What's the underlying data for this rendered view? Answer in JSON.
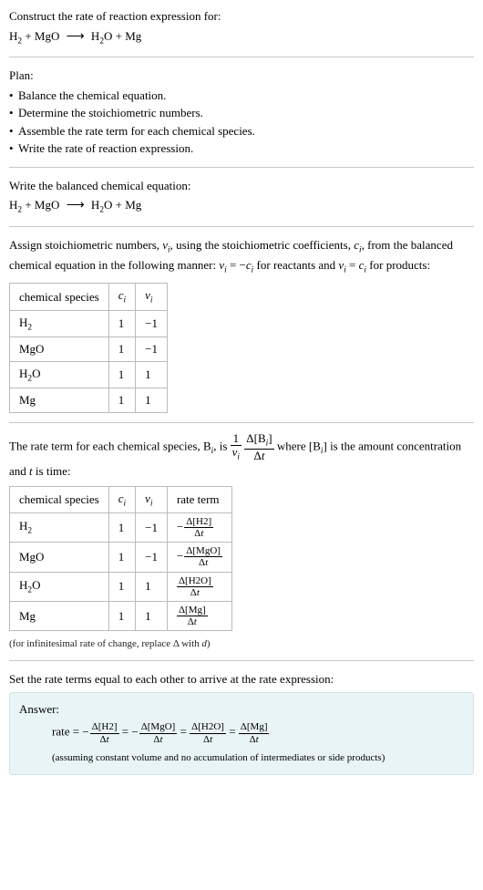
{
  "header": {
    "prompt": "Construct the rate of reaction expression for:",
    "equation_left": "H",
    "equation_sub1": "2",
    "equation_plus1": " + MgO ",
    "equation_right": " H",
    "equation_sub2": "2",
    "equation_end": "O + Mg"
  },
  "plan": {
    "title": "Plan:",
    "items": [
      "Balance the chemical equation.",
      "Determine the stoichiometric numbers.",
      "Assemble the rate term for each chemical species.",
      "Write the rate of reaction expression."
    ]
  },
  "balanced": {
    "title": "Write the balanced chemical equation:"
  },
  "stoich_intro": {
    "part1": "Assign stoichiometric numbers, ",
    "nu": "ν",
    "sub_i": "i",
    "part2": ", using the stoichiometric coefficients, ",
    "c": "c",
    "part3": ", from the balanced chemical equation in the following manner: ",
    "eq1": " = −",
    "part4": " for reactants and ",
    "eq2": " = ",
    "part5": " for products:"
  },
  "table1": {
    "headers": [
      "chemical species",
      "cᵢ",
      "νᵢ"
    ],
    "rows": [
      {
        "species_html": "H<sub>2</sub>",
        "c": "1",
        "nu": "−1"
      },
      {
        "species_html": "MgO",
        "c": "1",
        "nu": "−1"
      },
      {
        "species_html": "H<sub>2</sub>O",
        "c": "1",
        "nu": "1"
      },
      {
        "species_html": "Mg",
        "c": "1",
        "nu": "1"
      }
    ]
  },
  "rate_term_intro": {
    "part1": "The rate term for each chemical species, B",
    "part2": ", is ",
    "frac1_num": "1",
    "frac1_den_nu": "ν",
    "frac2_num": "Δ[B",
    "frac2_num_end": "]",
    "frac2_den": "Δt",
    "part3": " where [B",
    "part4": "] is the amount concentration and ",
    "t": "t",
    "part5": " is time:"
  },
  "table2": {
    "headers": [
      "chemical species",
      "cᵢ",
      "νᵢ",
      "rate term"
    ],
    "rows": [
      {
        "species": "H2",
        "c": "1",
        "nu": "−1",
        "rate_neg": true,
        "rate_top": "Δ[H2]",
        "rate_bot": "Δt"
      },
      {
        "species": "MgO",
        "c": "1",
        "nu": "−1",
        "rate_neg": true,
        "rate_top": "Δ[MgO]",
        "rate_bot": "Δt"
      },
      {
        "species": "H2O",
        "c": "1",
        "nu": "1",
        "rate_neg": false,
        "rate_top": "Δ[H2O]",
        "rate_bot": "Δt"
      },
      {
        "species": "Mg",
        "c": "1",
        "nu": "1",
        "rate_neg": false,
        "rate_top": "Δ[Mg]",
        "rate_bot": "Δt"
      }
    ]
  },
  "rate_note": "(for infinitesimal rate of change, replace Δ with d)",
  "final_title": "Set the rate terms equal to each other to arrive at the rate expression:",
  "answer": {
    "label": "Answer:",
    "rate_text": "rate = ",
    "neg": "−",
    "eq": " = ",
    "f1_top": "Δ[H2]",
    "f1_bot": "Δt",
    "f2_top": "Δ[MgO]",
    "f2_bot": "Δt",
    "f3_top": "Δ[H2O]",
    "f3_bot": "Δt",
    "f4_top": "Δ[Mg]",
    "f4_bot": "Δt",
    "note": "(assuming constant volume and no accumulation of intermediates or side products)"
  },
  "symbols": {
    "c_i": "c",
    "nu_i": "ν",
    "i": "i"
  }
}
